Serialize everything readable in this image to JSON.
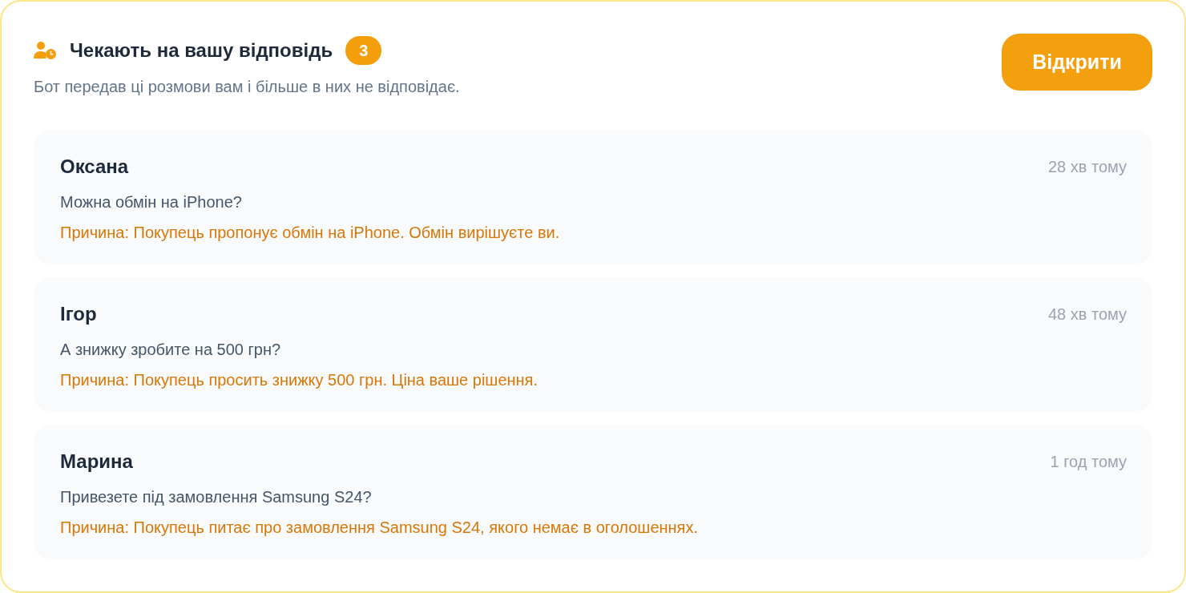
{
  "header": {
    "title": "Чекають на вашу відповідь",
    "count": "3",
    "subtitle": "Бот передав ці розмови вам і більше в них не відповідає.",
    "button": "Відкрити"
  },
  "conversations": [
    {
      "name": "Оксана",
      "time": "28 хв тому",
      "message": "Можна обмін на iPhone?",
      "reason": "Причина: Покупець пропонує обмін на iPhone. Обмін вирішуєте ви."
    },
    {
      "name": "Ігор",
      "time": "48 хв тому",
      "message": "А знижку зробите на 500 грн?",
      "reason": "Причина: Покупець просить знижку 500 грн. Ціна ваше рішення."
    },
    {
      "name": "Марина",
      "time": "1 год тому",
      "message": "Привезете під замовлення Samsung S24?",
      "reason": "Причина: Покупець питає про замовлення Samsung S24, якого немає в оголошеннях."
    }
  ]
}
